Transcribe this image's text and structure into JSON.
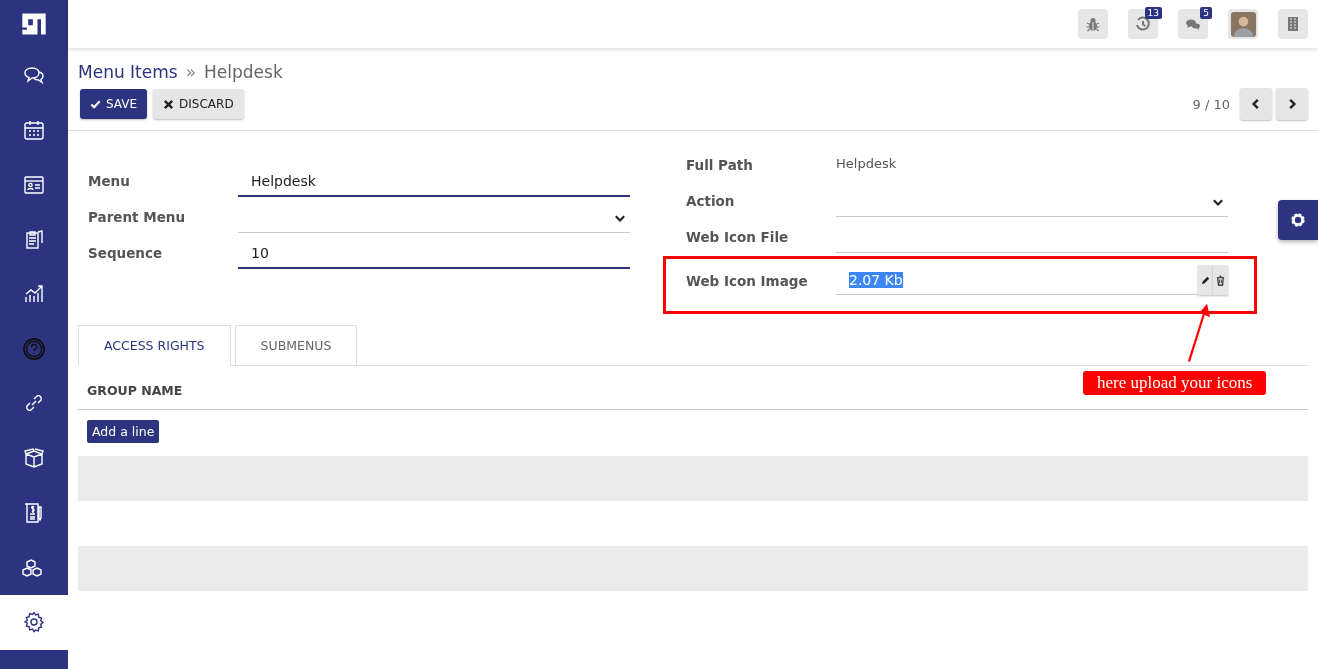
{
  "sidebar": {
    "items": [
      {
        "kind": "logo",
        "selected": false
      },
      {
        "kind": "chat",
        "selected": false
      },
      {
        "kind": "calendar",
        "selected": false
      },
      {
        "kind": "contact",
        "selected": false
      },
      {
        "kind": "clipboard",
        "selected": false
      },
      {
        "kind": "chart",
        "selected": false
      },
      {
        "kind": "help",
        "selected": false
      },
      {
        "kind": "link",
        "selected": false
      },
      {
        "kind": "box",
        "selected": false
      },
      {
        "kind": "invoice",
        "selected": false
      },
      {
        "kind": "cubes",
        "selected": false
      },
      {
        "kind": "gear",
        "selected": true
      }
    ]
  },
  "topbar": {
    "items": [
      {
        "kind": "bug"
      },
      {
        "kind": "clock",
        "badge": "13"
      },
      {
        "kind": "chat",
        "badge": "5"
      },
      {
        "kind": "avatar"
      },
      {
        "kind": "building"
      }
    ]
  },
  "breadcrumb": {
    "parent": "Menu Items",
    "separator": "»",
    "current": "Helpdesk"
  },
  "buttons": [
    {
      "kind": "save",
      "label": "SAVE"
    },
    {
      "kind": "discard",
      "label": "DISCARD"
    }
  ],
  "pager": "9 / 10",
  "form_left": [
    {
      "label": "Menu",
      "kind": "text",
      "value": "Helpdesk"
    },
    {
      "label": "Parent Menu",
      "kind": "select"
    },
    {
      "label": "Sequence",
      "kind": "text",
      "value": "10"
    }
  ],
  "form_right": [
    {
      "label": "Full Path",
      "kind": "readonly",
      "value": "Helpdesk"
    },
    {
      "label": "Action",
      "kind": "select"
    },
    {
      "label": "Web Icon File",
      "kind": "plain"
    },
    {
      "label": "Web Icon Image",
      "kind": "binary",
      "value": "2.07 Kb"
    }
  ],
  "tabs": [
    {
      "label": "ACCESS RIGHTS",
      "selected": true
    },
    {
      "label": "SUBMENUS",
      "selected": false
    }
  ],
  "table": {
    "columns": [
      "GROUP NAME"
    ],
    "add_line": "Add a line"
  },
  "annotation": {
    "text": "here upload your icons"
  }
}
